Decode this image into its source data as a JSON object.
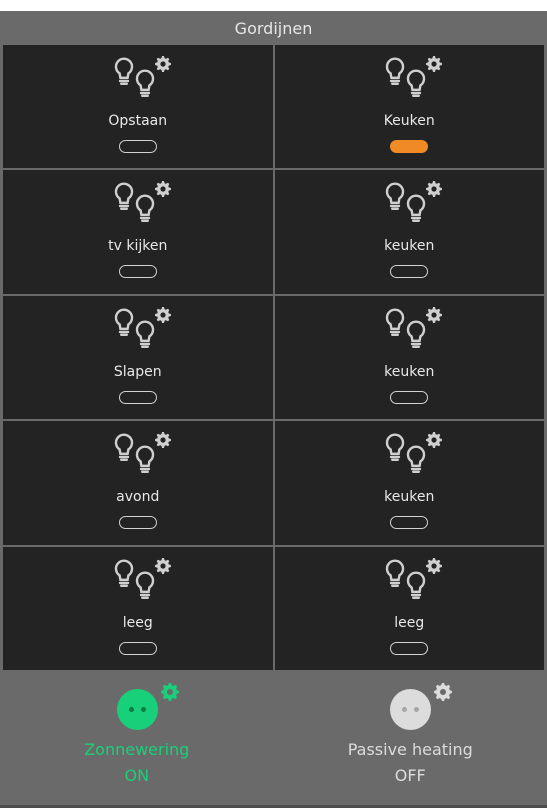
{
  "header": {
    "title": "Gordijnen"
  },
  "scenes": [
    {
      "label": "Opstaan",
      "on": false
    },
    {
      "label": "Keuken",
      "on": true
    },
    {
      "label": "tv kijken",
      "on": false
    },
    {
      "label": "keuken",
      "on": false
    },
    {
      "label": "Slapen",
      "on": false
    },
    {
      "label": "keuken",
      "on": false
    },
    {
      "label": "avond",
      "on": false
    },
    {
      "label": "keuken",
      "on": false
    },
    {
      "label": "leeg",
      "on": false
    },
    {
      "label": "leeg",
      "on": false
    }
  ],
  "devices": [
    {
      "name": "Zonnewering",
      "state": "ON",
      "on": true
    },
    {
      "name": "Passive heating",
      "state": "OFF",
      "on": false
    }
  ],
  "colors": {
    "toggle_on": "#f08a24",
    "device_on": "#19d07a",
    "device_off": "#dcdcdc"
  },
  "icons": {
    "scene": "light-bulbs-icon",
    "scene_settings": "gear-icon",
    "device": "power-outlet-icon"
  }
}
